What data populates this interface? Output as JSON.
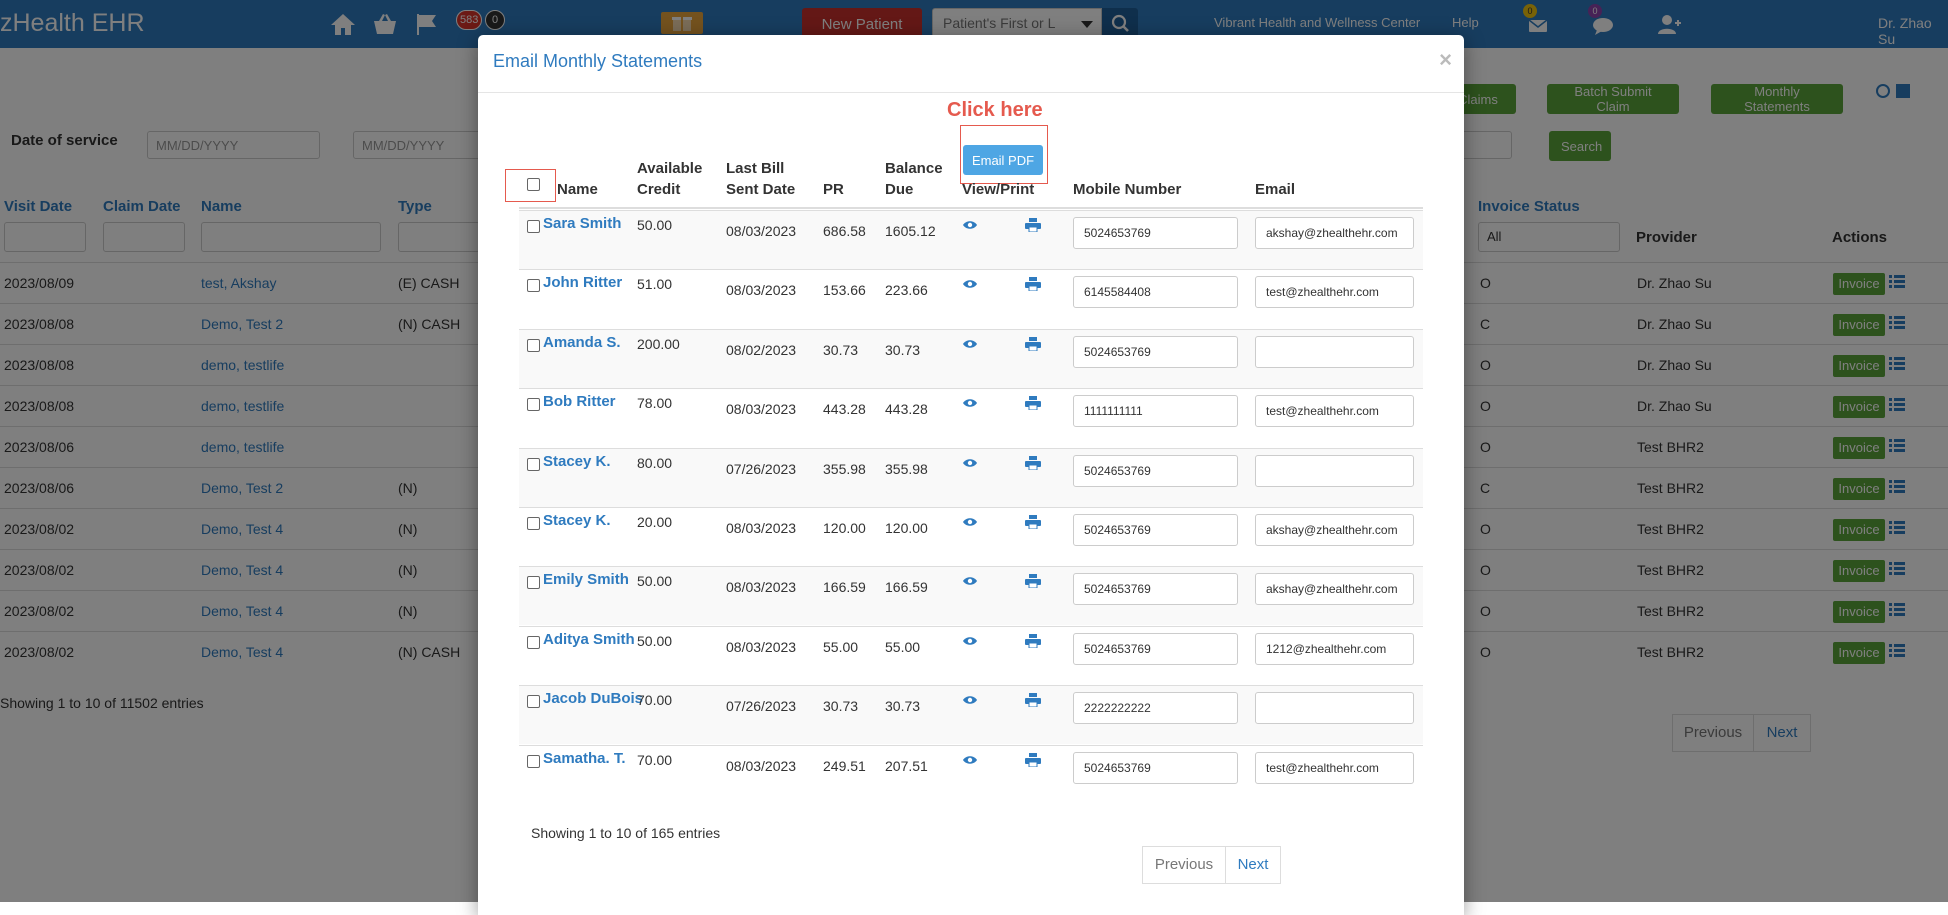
{
  "nav": {
    "brand": "zHealth EHR",
    "badge_red": "583",
    "badge_dark": "0",
    "new_patient": "New Patient",
    "patient_search_placeholder": "Patient's First or L",
    "clinic": "Vibrant Health and Wellness Center",
    "help": "Help",
    "mail_badge": "0",
    "chat_badge": "0",
    "user": "Dr. Zhao Su"
  },
  "page": {
    "date_of_service_label": "Date of service",
    "date_placeholder": "MM/DD/YYYY",
    "buttons": {
      "claims": "Claims",
      "batch_submit": "Batch Submit Claim",
      "monthly_statements": "Monthly Statements",
      "search": "Search"
    },
    "columns": {
      "visit_date": "Visit Date",
      "claim_date": "Claim Date",
      "name": "Name",
      "type": "Type",
      "invoice_status": "Invoice Status",
      "provider": "Provider",
      "actions": "Actions"
    },
    "invoice_status_filter": "All",
    "rows": [
      {
        "visit_date": "2023/08/09",
        "name": "test, Akshay",
        "type": "(E) CASH",
        "status": "O",
        "provider": "Dr. Zhao Su"
      },
      {
        "visit_date": "2023/08/08",
        "name": "Demo, Test 2",
        "type": "(N) CASH",
        "status": "C",
        "provider": "Dr. Zhao Su"
      },
      {
        "visit_date": "2023/08/08",
        "name": "demo, testlife",
        "type": "",
        "status": "O",
        "provider": "Dr. Zhao Su"
      },
      {
        "visit_date": "2023/08/08",
        "name": "demo, testlife",
        "type": "",
        "status": "O",
        "provider": "Dr. Zhao Su"
      },
      {
        "visit_date": "2023/08/06",
        "name": "demo, testlife",
        "type": "",
        "status": "O",
        "provider": "Test BHR2"
      },
      {
        "visit_date": "2023/08/06",
        "name": "Demo, Test 2",
        "type": "(N)",
        "status": "C",
        "provider": "Test BHR2"
      },
      {
        "visit_date": "2023/08/02",
        "name": "Demo, Test 4",
        "type": "(N)",
        "status": "O",
        "provider": "Test BHR2"
      },
      {
        "visit_date": "2023/08/02",
        "name": "Demo, Test 4",
        "type": "(N)",
        "status": "O",
        "provider": "Test BHR2"
      },
      {
        "visit_date": "2023/08/02",
        "name": "Demo, Test 4",
        "type": "(N)",
        "status": "O",
        "provider": "Test BHR2"
      },
      {
        "visit_date": "2023/08/02",
        "name": "Demo, Test 4",
        "type": "(N) CASH",
        "status": "O",
        "provider": "Test BHR2"
      }
    ],
    "invoice_label": "Invoice",
    "footer": "Showing 1 to 10 of 11502 entries",
    "prev": "Previous",
    "next": "Next"
  },
  "modal": {
    "title": "Email Monthly Statements",
    "close": "×",
    "annotation": "Click here",
    "email_pdf": "Email PDF",
    "headers": {
      "name": "Name",
      "available_credit_1": "Available",
      "available_credit_2": "Credit",
      "last_bill_1": "Last Bill",
      "last_bill_2": "Sent Date",
      "pr": "PR",
      "balance_1": "Balance",
      "balance_2": "Due",
      "view_print": "View/Print",
      "mobile": "Mobile Number",
      "email": "Email"
    },
    "rows": [
      {
        "name": "Sara Smith",
        "credit": "50.00",
        "last_bill": "08/03/2023",
        "pr": "686.58",
        "balance": "1605.12",
        "mobile": "5024653769",
        "email": "akshay@zhealthehr.com"
      },
      {
        "name": "John Ritter",
        "credit": "51.00",
        "last_bill": "08/03/2023",
        "pr": "153.66",
        "balance": "223.66",
        "mobile": "6145584408",
        "email": "test@zhealthehr.com"
      },
      {
        "name": "Amanda S.",
        "credit": "200.00",
        "last_bill": "08/02/2023",
        "pr": "30.73",
        "balance": "30.73",
        "mobile": "5024653769",
        "email": ""
      },
      {
        "name": "Bob Ritter",
        "credit": "78.00",
        "last_bill": "08/03/2023",
        "pr": "443.28",
        "balance": "443.28",
        "mobile": "1111111111",
        "email": "test@zhealthehr.com"
      },
      {
        "name": "Stacey K.",
        "credit": "80.00",
        "last_bill": "07/26/2023",
        "pr": "355.98",
        "balance": "355.98",
        "mobile": "5024653769",
        "email": ""
      },
      {
        "name": "Stacey K.",
        "credit": "20.00",
        "last_bill": "08/03/2023",
        "pr": "120.00",
        "balance": "120.00",
        "mobile": "5024653769",
        "email": "akshay@zhealthehr.com"
      },
      {
        "name": "Emily Smith",
        "credit": "50.00",
        "last_bill": "08/03/2023",
        "pr": "166.59",
        "balance": "166.59",
        "mobile": "5024653769",
        "email": "akshay@zhealthehr.com"
      },
      {
        "name": "Aditya Smith",
        "credit": "50.00",
        "last_bill": "08/03/2023",
        "pr": "55.00",
        "balance": "55.00",
        "mobile": "5024653769",
        "email": "1212@zhealthehr.com"
      },
      {
        "name": "Jacob DuBois",
        "credit": "70.00",
        "last_bill": "07/26/2023",
        "pr": "30.73",
        "balance": "30.73",
        "mobile": "2222222222",
        "email": ""
      },
      {
        "name": "Samatha. T.",
        "credit": "70.00",
        "last_bill": "08/03/2023",
        "pr": "249.51",
        "balance": "207.51",
        "mobile": "5024653769",
        "email": "test@zhealthehr.com"
      }
    ],
    "footer": "Showing 1 to 10 of 165 entries",
    "prev": "Previous",
    "next": "Next"
  },
  "colors": {
    "nav": "#2f7bbf",
    "link": "#2f7bbf",
    "green": "#5aa53a",
    "new_patient": "#c9302c",
    "annotation": "#e55a4e",
    "email_pdf": "#4ea6e4"
  }
}
